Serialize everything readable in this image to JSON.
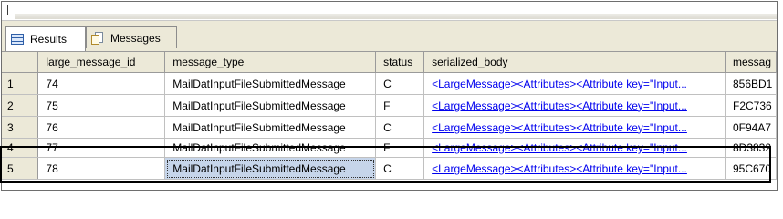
{
  "tabs": [
    {
      "label": "Results",
      "icon": "grid-icon",
      "active": true
    },
    {
      "label": "Messages",
      "icon": "messages-icon",
      "active": false
    }
  ],
  "columns": [
    "large_message_id",
    "message_type",
    "status",
    "serialized_body",
    "messag"
  ],
  "rows": [
    {
      "num": "1",
      "large_message_id": "74",
      "message_type": "MailDatInputFileSubmittedMessage",
      "status": "C",
      "serialized_body": "<LargeMessage><Attributes><Attribute key=\"Input...",
      "message": "856BD1"
    },
    {
      "num": "2",
      "large_message_id": "75",
      "message_type": "MailDatInputFileSubmittedMessage",
      "status": "F",
      "serialized_body": "<LargeMessage><Attributes><Attribute key=\"Input...",
      "message": "F2C736"
    },
    {
      "num": "3",
      "large_message_id": "76",
      "message_type": "MailDatInputFileSubmittedMessage",
      "status": "C",
      "serialized_body": "<LargeMessage><Attributes><Attribute key=\"Input...",
      "message": "0F94A7"
    },
    {
      "num": "4",
      "large_message_id": "77",
      "message_type": "MailDatInputFileSubmittedMessage",
      "status": "F",
      "serialized_body": "<LargeMessage><Attributes><Attribute key=\"Input...",
      "message": "8D3832"
    },
    {
      "num": "5",
      "large_message_id": "78",
      "message_type": "MailDatInputFileSubmittedMessage",
      "status": "C",
      "serialized_body": "<LargeMessage><Attributes><Attribute key=\"Input...",
      "message": "95C670"
    }
  ],
  "selected_row": 5,
  "colors": {
    "link": "#0000ee",
    "header_bg": "#ece9d8",
    "selected_cell": "#c6d5ea"
  }
}
